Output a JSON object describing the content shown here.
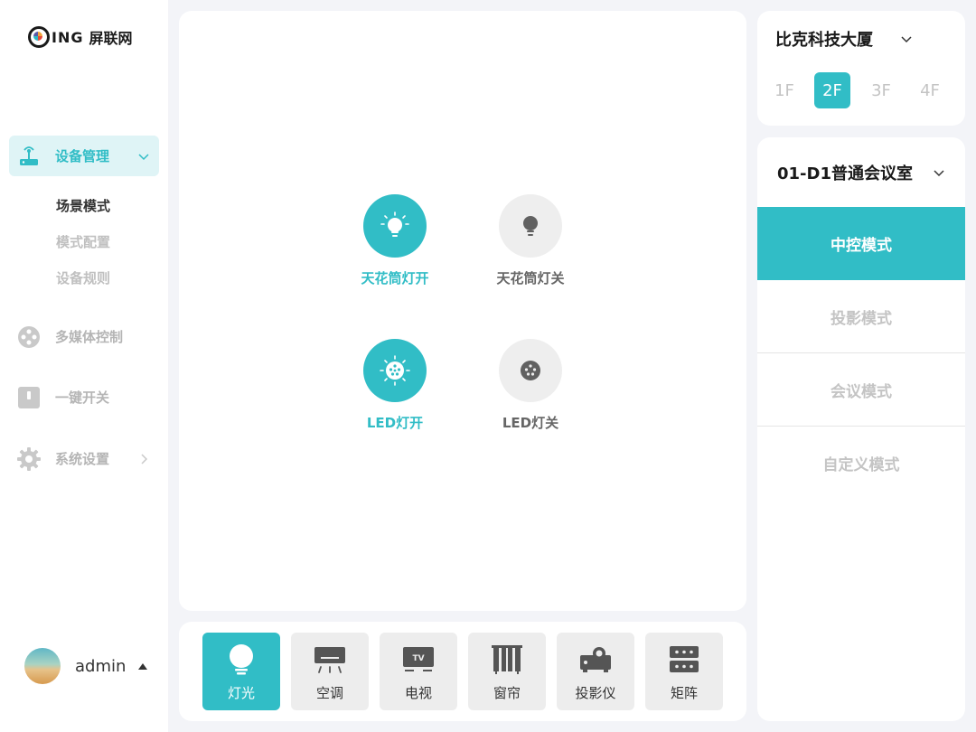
{
  "logo": {
    "text_en": "ING",
    "text_cn": "屏联网"
  },
  "sidebar": {
    "active_menu": {
      "label": "设备管理",
      "icon": "router-icon"
    },
    "submenu": [
      {
        "label": "场景模式",
        "current": true
      },
      {
        "label": "模式配置",
        "current": false
      },
      {
        "label": "设备规则",
        "current": false
      }
    ],
    "menu": [
      {
        "label": "多媒体控制",
        "icon": "film-reel-icon"
      },
      {
        "label": "一键开关",
        "icon": "switch-icon"
      },
      {
        "label": "系统设置",
        "icon": "gear-icon"
      }
    ]
  },
  "user": {
    "name": "admin"
  },
  "controls": [
    {
      "label": "天花筒灯开",
      "state": "on",
      "icon": "bulb-on-icon"
    },
    {
      "label": "天花筒灯关",
      "state": "off",
      "icon": "bulb-off-icon"
    },
    {
      "label": "LED灯开",
      "state": "on",
      "icon": "led-on-icon"
    },
    {
      "label": "LED灯关",
      "state": "off",
      "icon": "led-off-icon"
    }
  ],
  "devices": [
    {
      "label": "灯光",
      "icon": "lightbulb-icon",
      "active": true
    },
    {
      "label": "空调",
      "icon": "air-conditioner-icon",
      "active": false
    },
    {
      "label": "电视",
      "icon": "tv-icon",
      "active": false
    },
    {
      "label": "窗帘",
      "icon": "curtain-icon",
      "active": false
    },
    {
      "label": "投影仪",
      "icon": "projector-icon",
      "active": false
    },
    {
      "label": "矩阵",
      "icon": "matrix-icon",
      "active": false
    }
  ],
  "building": {
    "name": "比克科技大厦",
    "floors": [
      "1F",
      "2F",
      "3F",
      "4F"
    ],
    "active_floor": "2F"
  },
  "room": {
    "name": "01-D1普通会议室",
    "modes": [
      "中控模式",
      "投影模式",
      "会议模式",
      "自定义模式"
    ],
    "active_mode": "中控模式"
  },
  "colors": {
    "accent": "#31bdc6",
    "background": "#f3f4f8"
  }
}
